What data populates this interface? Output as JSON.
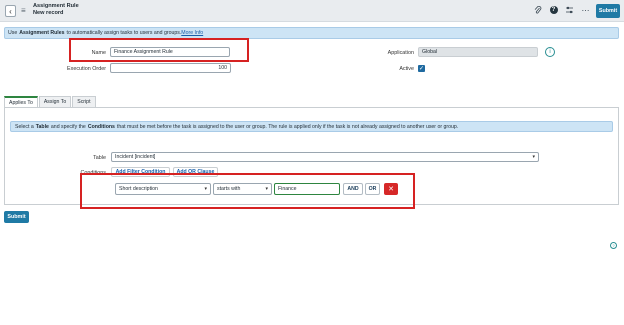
{
  "header": {
    "title": "Assignment Rule",
    "subtitle": "New record",
    "submit_label": "Submit",
    "icons": [
      "attachment-icon",
      "help-icon",
      "settings-icon",
      "more-icon"
    ]
  },
  "info_bar": {
    "prefix": "Use",
    "bold": "Assignment Rules",
    "text": "to automatically assign tasks to users and groups.",
    "link": "More Info"
  },
  "form": {
    "name_label": "Name",
    "name_value": "Finance Assignment Rule",
    "execution_order_label": "Execution Order",
    "execution_order_value": "100",
    "application_label": "Application",
    "application_value": "Global",
    "active_label": "Active",
    "active_checked": true
  },
  "tabs": [
    "Applies To",
    "Assign To",
    "Script"
  ],
  "applies_to": {
    "info": {
      "t1": "Select a",
      "b1": "Table",
      "t2": "and specify the",
      "b2": "Conditions",
      "t3": "that must be met before the task is assigned to the user or group. The rule is applied only if the task is not already assigned to another user or group."
    },
    "table_label": "Table",
    "table_value": "Incident [incident]",
    "conditions_label": "Conditions",
    "add_filter_label": "Add Filter Condition",
    "add_or_label": "Add OR Clause",
    "condition": {
      "field": "Short description",
      "operator": "starts with",
      "value": "Finance",
      "and_label": "AND",
      "or_label": "OR"
    }
  },
  "footer": {
    "submit_label": "Submit"
  },
  "colors": {
    "accent": "#1f7aa5",
    "highlight_box": "#d62222",
    "info_bg": "#cde4f5",
    "delete_red": "#d62828"
  }
}
